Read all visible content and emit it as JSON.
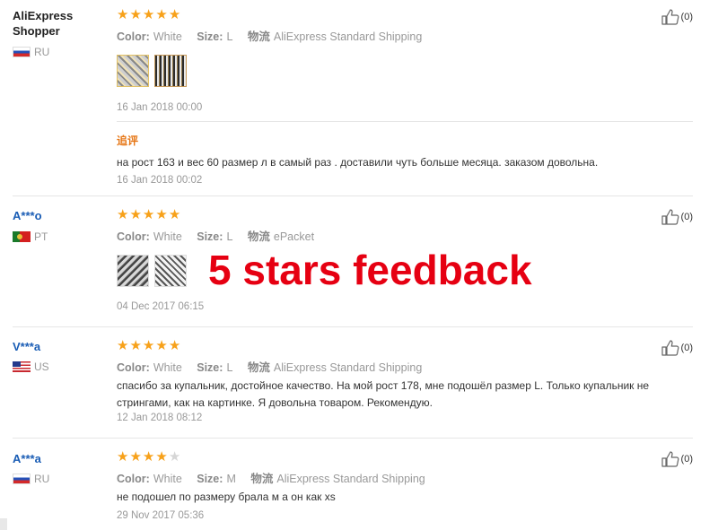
{
  "labels": {
    "color_key": "Color:",
    "size_key": "Size:",
    "shipping_key": "物流"
  },
  "overlay_text": "5 stars feedback",
  "reviews": [
    {
      "user": "AliExpress Shopper",
      "country": "RU",
      "rating": 5,
      "color": "White",
      "size": "L",
      "shipping": "AliExpress Standard Shipping",
      "likes": "(0)",
      "date": "16 Jan 2018 00:00",
      "append_label": "追评",
      "append_text": "на рост 163 и вес 60 размер л в самый раз . доставили чуть больше месяца. заказом довольна.",
      "append_date": "16 Jan 2018 00:02"
    },
    {
      "user": "A***o",
      "country": "PT",
      "rating": 5,
      "color": "White",
      "size": "L",
      "shipping": "ePacket",
      "likes": "(0)",
      "date": "04 Dec 2017 06:15"
    },
    {
      "user": "V***a",
      "country": "US",
      "rating": 5,
      "color": "White",
      "size": "L",
      "shipping": "AliExpress Standard Shipping",
      "likes": "(0)",
      "text_line1": "спасибо за купальник, достойное качество. На мой рост 178, мне подошёл размер L. Только купальник не",
      "text_line2": "стрингами, как на картинке. Я довольна товаром. Рекомендую.",
      "date": "12 Jan 2018 08:12"
    },
    {
      "user": "A***a",
      "country": "RU",
      "rating": 4,
      "color": "White",
      "size": "M",
      "shipping": "AliExpress Standard Shipping",
      "likes": "(0)",
      "text": "не подошел по размеру брала м а он как xs",
      "date": "29 Nov 2017 05:36"
    }
  ]
}
